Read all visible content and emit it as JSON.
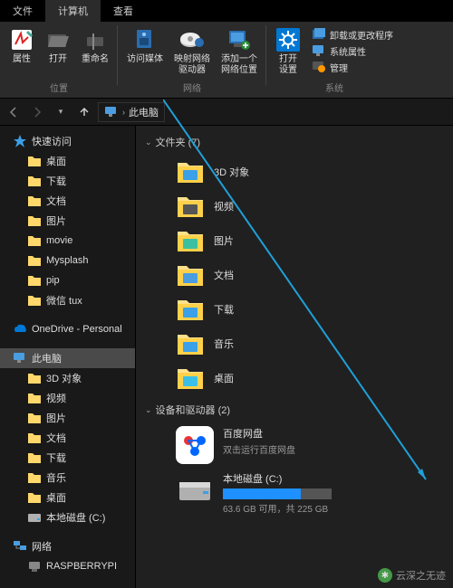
{
  "tabs": {
    "file": "文件",
    "computer": "计算机",
    "view": "查看"
  },
  "ribbon": {
    "loc": {
      "props": "属性",
      "open": "打开",
      "rename": "重命名",
      "group": "位置"
    },
    "net": {
      "media": "访问媒体",
      "map": "映射网络\n驱动器",
      "addloc": "添加一个\n网络位置",
      "group": "网络"
    },
    "sys": {
      "settings": "打开\n设置",
      "uninstall": "卸载或更改程序",
      "sysprops": "系统属性",
      "manage": "管理",
      "group": "系统"
    }
  },
  "crumb": {
    "label": "此电脑"
  },
  "sidebar": {
    "quick": "快速访问",
    "quick_items": [
      "桌面",
      "下载",
      "文档",
      "图片",
      "movie",
      "Mysplash",
      "pip",
      "微信 tux"
    ],
    "onedrive": "OneDrive - Personal",
    "thispc": "此电脑",
    "pc_items": [
      "3D 对象",
      "视频",
      "图片",
      "文档",
      "下载",
      "音乐",
      "桌面",
      "本地磁盘 (C:)"
    ],
    "network": "网络",
    "net_items": [
      "RASPBERRYPI"
    ]
  },
  "content": {
    "folders_head": "文件夹 (7)",
    "folders": [
      "3D 对象",
      "视频",
      "图片",
      "文档",
      "下载",
      "音乐",
      "桌面"
    ],
    "drives_head": "设备和驱动器 (2)",
    "baidu": {
      "name": "百度网盘",
      "sub": "双击运行百度网盘"
    },
    "cdrive": {
      "name": "本地磁盘 (C:)",
      "stat": "63.6 GB 可用，共 225 GB",
      "fill": 72
    }
  },
  "watermark": "云深之无迹"
}
